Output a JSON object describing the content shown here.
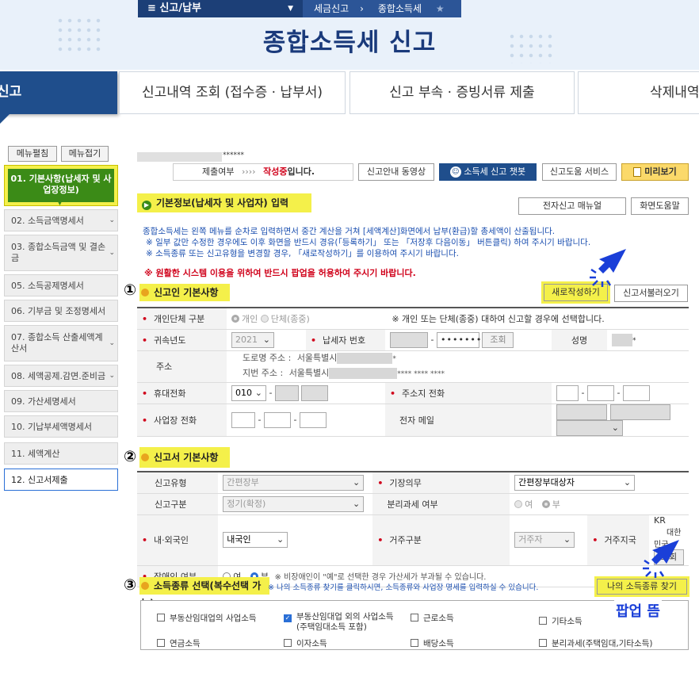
{
  "header": {
    "menu_label": "≡ 신고/납부",
    "breadcrumb": [
      "세금신고",
      "종합소득세"
    ],
    "page_title": "종합소득세 신고"
  },
  "tabs": [
    {
      "label": "신고"
    },
    {
      "label": "신고내역 조회 (접수증 · 납부서)"
    },
    {
      "label": "신고 부속 · 증빙서류 제출"
    },
    {
      "label": "삭제내역"
    }
  ],
  "sidebar": {
    "expand_label": "메뉴펼침",
    "collapse_label": "메뉴접기",
    "items": [
      {
        "label": "01. 기본사항(납세자 및 사업장정보)"
      },
      {
        "label": "02. 소득금액명세서"
      },
      {
        "label": "03. 종합소득금액 및 결손금"
      },
      {
        "label": "05. 소득공제명세서"
      },
      {
        "label": "06. 기부금 및 조정명세서"
      },
      {
        "label": "07. 종합소득 산출세액계산서"
      },
      {
        "label": "08. 세액공제.감면.준비금"
      },
      {
        "label": "09. 가산세명세서"
      },
      {
        "label": "10. 기납부세액명세서"
      },
      {
        "label": "11. 세액계산"
      },
      {
        "label": "12. 신고서제출"
      }
    ]
  },
  "toolbar": {
    "user_suffix": "******",
    "status_prefix": "제출여부",
    "status_arrows": "››››",
    "status_value": "작성중",
    "status_suffix": "입니다.",
    "guide_video": "신고안내 동영상",
    "chatbot": "소득세 신고 챗봇",
    "help_service": "신고도움 서비스",
    "preview": "미리보기"
  },
  "section_basic": {
    "title": "기본정보(납세자 및 사업자) 입력",
    "manual_button": "전자신고 매뉴얼",
    "screen_help_button": "화면도움말",
    "info_lines": [
      "종합소득세는 왼쪽 메뉴를 순차로 입력하면서 중간 계산을 거쳐 [세액계산]화면에서 납부(환급)할 총세액이 산출됩니다.",
      "※ 일부 값만 수정한 경우에도 이후 화면을 반드시 경유(「등록하기」 또는 「저장후 다음이동」 버튼클릭) 하여 주시기 바랍니다.",
      "※ 소득종류 또는 신고유형을 변경할 경우, 「새로작성하기」를 이용하여 주시기 바랍니다."
    ],
    "warning": "※ 원활한 시스템 이용을 위하여 반드시 팝업을 허용하여 주시기 바랍니다."
  },
  "section1": {
    "number": "①",
    "title": "신고인 기본사항",
    "new_button": "새로작성하기",
    "load_button": "신고서불러오기",
    "type_label": "개인단체 구분",
    "type_individual": "개인",
    "type_group": "단체(종중)",
    "type_note": "※ 개인 또는 단체(종중) 대하여 신고할 경우에 선택합니다.",
    "year_label": "귀속년도",
    "year_value": "2021",
    "taxid_label": "납세자 번호",
    "taxid_dash": "-",
    "taxid_masked": "•••••••",
    "lookup_button": "조회",
    "name_label": "성명",
    "name_suffix": "*",
    "address_label": "주소",
    "road_label": "도로명 주소 :",
    "road_city": "서울특별시",
    "road_suffix": "*",
    "lot_label": "지번 주소 :",
    "lot_city": "서울특별시",
    "lot_suffix": "**** **** ****",
    "mobile_label": "휴대전화",
    "mobile_prefix": "010",
    "home_phone_label": "주소지 전화",
    "biz_phone_label": "사업장 전화",
    "email_label": "전자 메일"
  },
  "section2": {
    "number": "②",
    "title": "신고서 기본사항",
    "report_type_label": "신고유형",
    "report_type_value": "간편장부",
    "bookkeeping_label": "기장의무",
    "bookkeeping_value": "간편장부대상자",
    "report_kind_label": "신고구분",
    "report_kind_value": "정기(확정)",
    "separate_tax_label": "분리과세 여부",
    "yes": "여",
    "no": "부",
    "nationality_label": "내·외국인",
    "nationality_value": "내국인",
    "residence_label": "거주구분",
    "residence_value": "거주자",
    "residence_country_label": "거주지국",
    "country_code": "KR",
    "country_name": "대한민국",
    "country_lookup": "조회",
    "disabled_label": "장애인 여부",
    "disabled_note": "※ 비장애인이 \"예\"로 선택한 경우 가산세가 부과될 수 있습니다."
  },
  "section3": {
    "number": "③",
    "title": "소득종류 선택(복수선택 가능)",
    "note": "※ 나의 소득종류 찾기를 클릭하시면, 소득종류와 사업장 명세를 입력하실 수 있습니다.",
    "find_button": "나의 소득종류 찾기",
    "popup_note": "팝업 뜸",
    "options": [
      {
        "label": "부동산임대업의 사업소득",
        "checked": false
      },
      {
        "label": "부동산임대업 외의 사업소득 (주택임대소득 포함)",
        "checked": true
      },
      {
        "label": "근로소득",
        "checked": false
      },
      {
        "label": "기타소득",
        "checked": false
      },
      {
        "label": "연금소득",
        "checked": false
      },
      {
        "label": "이자소득",
        "checked": false
      },
      {
        "label": "배당소득",
        "checked": false
      },
      {
        "label": "분리과세(주택임대,기타소득)",
        "checked": false
      }
    ]
  },
  "colors": {
    "accent_navy": "#1f4e8c",
    "highlight_yellow": "#f4f04a",
    "active_green": "#3b8b17",
    "required_red": "#d0021b",
    "arrow_blue": "#1a3fd8"
  }
}
